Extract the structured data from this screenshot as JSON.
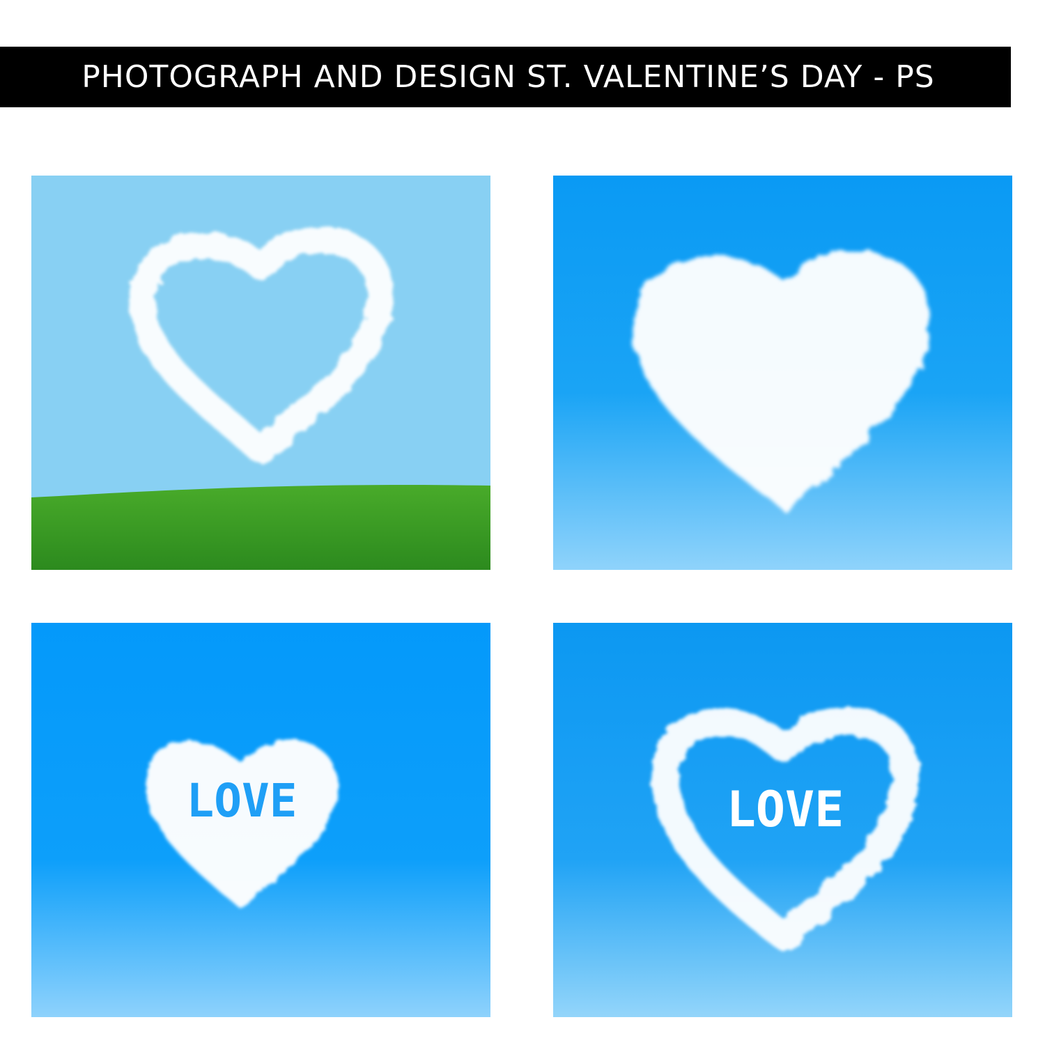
{
  "banner": {
    "title": "PHOTOGRAPH AND DESIGN ST. VALENTINE’S DAY - PS"
  },
  "panels": [
    {
      "kind": "outline-heart-over-grass"
    },
    {
      "kind": "filled-cloud-heart"
    },
    {
      "kind": "filled-cloud-heart-with-word",
      "word": "LOVE"
    },
    {
      "kind": "outline-heart-with-word",
      "word": "LOVE"
    }
  ],
  "colors": {
    "banner_bg": "#000000",
    "banner_text": "#ffffff",
    "sky_light": "#88d0f3",
    "sky_deep": "#0499fa",
    "grass": "#3c9a22",
    "cloud": "#ffffff"
  }
}
